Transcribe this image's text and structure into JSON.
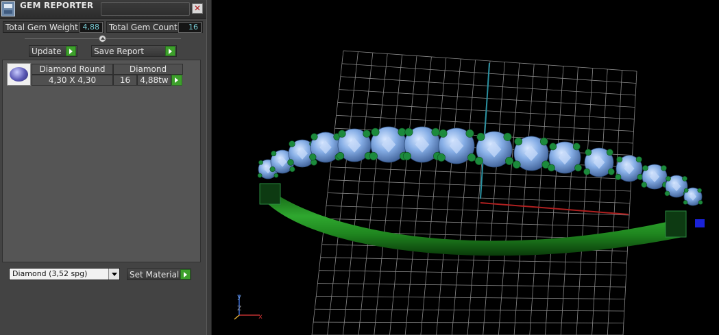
{
  "title": "GEM REPORTER",
  "icons": {
    "app": "gem-reporter-app-icon",
    "close": "close-icon"
  },
  "close_label": "✕",
  "stats": {
    "weight_label": "Total Gem Weight",
    "weight_value": "4,88",
    "count_label": "Total Gem Count",
    "count_value": "16"
  },
  "buttons": {
    "update": "Update",
    "save_report": "Save Report",
    "set_material": "Set Material"
  },
  "gem_row": {
    "shape": "Diamond Round",
    "material": "Diamond",
    "size": "4,30 X 4,30",
    "count": "16",
    "weight": "4,88tw"
  },
  "material_select": {
    "selected": "Diamond     (3,52 spg)"
  },
  "axis": {
    "x": "x",
    "y": "y",
    "z": "Z"
  },
  "colors": {
    "accent_green": "#3da02b",
    "value_cyan": "#79cdd6",
    "ring_green": "#1f8a1f",
    "gem_blue": "#7aa6e0"
  }
}
